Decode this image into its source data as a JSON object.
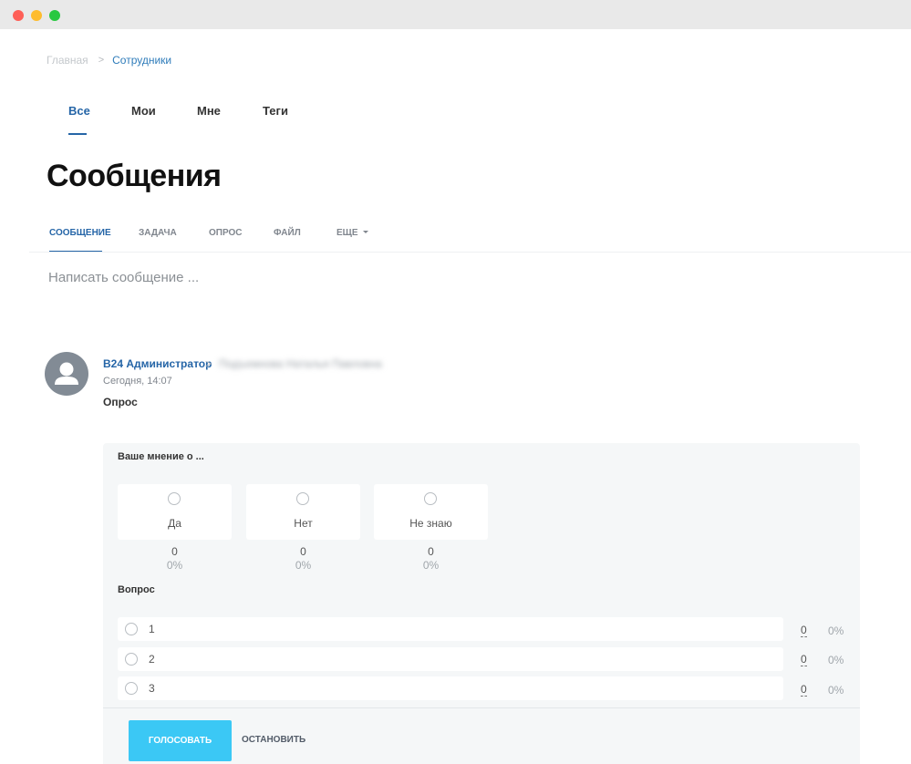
{
  "breadcrumb": {
    "home": "Главная",
    "separator": ">",
    "current": "Сотрудники"
  },
  "top_tabs": [
    {
      "label": "Все",
      "active": true
    },
    {
      "label": "Мои",
      "active": false
    },
    {
      "label": "Мне",
      "active": false
    },
    {
      "label": "Теги",
      "active": false
    }
  ],
  "page_title": "Сообщения",
  "post_tabs": [
    {
      "label": "СООБЩЕНИЕ",
      "active": true
    },
    {
      "label": "ЗАДАЧА",
      "active": false
    },
    {
      "label": "ОПРОС",
      "active": false
    },
    {
      "label": "ФАЙЛ",
      "active": false
    },
    {
      "label": "ЕЩЕ",
      "active": false
    }
  ],
  "composer_placeholder": "Написать сообщение ...",
  "post": {
    "author": "B24 Администратор",
    "arrow": ">",
    "recipient": "Подъемнова Наталья Павловна",
    "timestamp": "Сегодня, 14:07",
    "title": "Опрос"
  },
  "poll": {
    "question1": {
      "title": "Ваше мнение о ...",
      "answers": [
        {
          "label": "Да",
          "count": "0",
          "percent": "0%"
        },
        {
          "label": "Нет",
          "count": "0",
          "percent": "0%"
        },
        {
          "label": "Не знаю",
          "count": "0",
          "percent": "0%"
        }
      ]
    },
    "question2": {
      "title": "Вопрос",
      "answers": [
        {
          "label": "1",
          "count": "0",
          "percent": "0%"
        },
        {
          "label": "2",
          "count": "0",
          "percent": "0%"
        },
        {
          "label": "3",
          "count": "0",
          "percent": "0%"
        }
      ]
    },
    "vote_label": "ГОЛОСОВАТЬ",
    "stop_label": "ОСТАНОВИТЬ"
  },
  "colors": {
    "accent": "#2565a7",
    "link": "#2f7cba",
    "vote_button": "#3bc8f5",
    "panel_bg": "#f5f7f8"
  }
}
